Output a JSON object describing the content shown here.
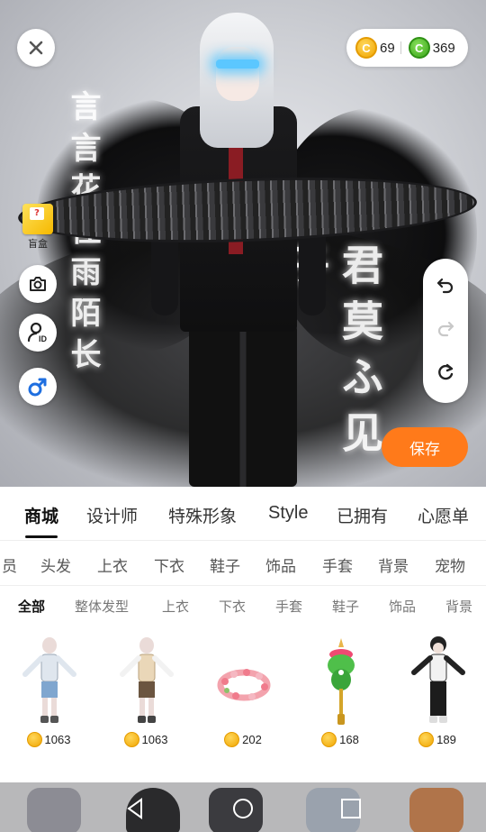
{
  "currency": {
    "gold": "69",
    "gold_symbol": "C",
    "green": "369",
    "green_symbol": "C"
  },
  "stage": {
    "blind_box_label": "盲盒",
    "blind_box_glyph": "?",
    "calligraphy_left": "言 言 花 佳 雨 陌 长",
    "calligraphy_right": "君 莫 ふ 见 子"
  },
  "save_label": "保存",
  "main_tabs": [
    {
      "label": "商城",
      "active": true
    },
    {
      "label": "设计师"
    },
    {
      "label": "特殊形象"
    },
    {
      "label": "Style"
    },
    {
      "label": "已拥有"
    },
    {
      "label": "心愿单"
    }
  ],
  "categories": [
    "员",
    "头发",
    "上衣",
    "下衣",
    "鞋子",
    "饰品",
    "手套",
    "背景",
    "宠物"
  ],
  "subcategories": [
    {
      "label": "全部",
      "active": true
    },
    {
      "label": "整体发型"
    },
    {
      "label": "上衣"
    },
    {
      "label": "下衣"
    },
    {
      "label": "手套"
    },
    {
      "label": "鞋子"
    },
    {
      "label": "饰品"
    },
    {
      "label": "背景"
    }
  ],
  "items": [
    {
      "price": "1063",
      "kind": "outfit-blue"
    },
    {
      "price": "1063",
      "kind": "outfit-tan"
    },
    {
      "price": "202",
      "kind": "flower-wreath"
    },
    {
      "price": "168",
      "kind": "green-pendant"
    },
    {
      "price": "189",
      "kind": "outfit-black"
    }
  ],
  "colors": {
    "accent": "#ff7a1a",
    "gold": "#f0a500",
    "green": "#3aa519"
  },
  "icons": [
    "close-icon",
    "camera-icon",
    "id-icon",
    "male-icon",
    "undo-icon",
    "redo-icon",
    "refresh-icon",
    "back-nav-icon",
    "home-nav-icon",
    "recents-nav-icon"
  ]
}
